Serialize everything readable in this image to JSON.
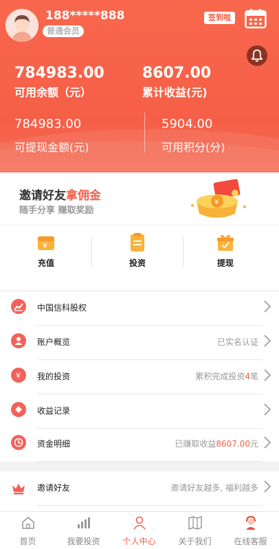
{
  "profile": {
    "phone": "188*****888",
    "member_level": "普通会员",
    "signin_label": "签到啦"
  },
  "balances": {
    "available_value": "784983.00",
    "available_label": "可用余额（元）",
    "earnings_value": "8607.00",
    "earnings_label": "累计收益(元)",
    "withdrawable_value": "784983.00",
    "withdrawable_label": "可提现金额(元)",
    "points_value": "5904.00",
    "points_label": "可用积分(分)"
  },
  "invite_banner": {
    "title_plain": "邀请好友",
    "title_highlight": "拿佣金",
    "subtitle": "随手分享 赚取奖励"
  },
  "actions": [
    {
      "label": "充值",
      "icon": "recharge-icon"
    },
    {
      "label": "投资",
      "icon": "invest-icon"
    },
    {
      "label": "提现",
      "icon": "withdraw-icon"
    }
  ],
  "menu": [
    {
      "label": "中国信科股权",
      "right": "",
      "icon": "chart-icon"
    },
    {
      "label": "账户概览",
      "right": "已实名认证",
      "icon": "user-icon"
    },
    {
      "label": "我的投资",
      "right_prefix": "累积完成投资",
      "right_highlight": "4",
      "right_suffix": "笔",
      "icon": "yen-icon"
    },
    {
      "label": "收益记录",
      "right": "",
      "icon": "diamond-icon"
    },
    {
      "label": "资金明细",
      "right_prefix": "已赚取收益",
      "right_highlight": "8607.00",
      "right_suffix": "元",
      "icon": "clock-icon"
    }
  ],
  "invite_row": {
    "label": "邀请好友",
    "right": "邀请好友越多, 福利越多",
    "icon": "crown-icon"
  },
  "tabbar": [
    {
      "label": "首页",
      "icon": "home-icon"
    },
    {
      "label": "我要投资",
      "icon": "bar-chart-icon"
    },
    {
      "label": "个人中心",
      "icon": "person-icon",
      "active": true
    },
    {
      "label": "关于我们",
      "icon": "book-icon"
    },
    {
      "label": "在线客服",
      "icon": "support-icon"
    }
  ],
  "colors": {
    "accent": "#f2604a",
    "header": "#f8674d"
  }
}
